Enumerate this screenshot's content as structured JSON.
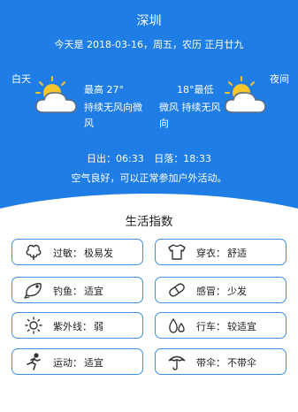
{
  "header": {
    "city": "深圳",
    "date_line": "今天是 2018-03-16，周五，农历 正月廿九"
  },
  "forecast": {
    "day_label": "白天",
    "night_label": "夜间",
    "high_temp": "最高 27°",
    "low_temp": "18°最低",
    "day_wind": "持续无风向微风",
    "night_wind": "微风 持续无风向",
    "day_icon": "partly-cloudy-sun-icon",
    "night_icon": "partly-cloudy-sun-icon"
  },
  "sun": {
    "sunrise": "日出：06:33",
    "sunset": "日落：18:33"
  },
  "advice": "空气良好，可以正常参加户外活动。",
  "life": {
    "title": "生活指数",
    "items": [
      {
        "name": "过敏：",
        "value": "极易发",
        "icon": "flower-icon"
      },
      {
        "name": "穿衣：",
        "value": "舒适",
        "icon": "tshirt-icon"
      },
      {
        "name": "钓鱼：",
        "value": "适宜",
        "icon": "fish-icon"
      },
      {
        "name": "感冒：",
        "value": "少发",
        "icon": "pill-icon"
      },
      {
        "name": "紫外线：",
        "value": "弱",
        "icon": "sun-icon"
      },
      {
        "name": "行车：",
        "value": "较适宜",
        "icon": "drops-icon"
      },
      {
        "name": "运动：",
        "value": "适宜",
        "icon": "runner-icon"
      },
      {
        "name": "带伞：",
        "value": "不带伞",
        "icon": "umbrella-icon"
      }
    ]
  },
  "colors": {
    "header_bg": "#1f7de6",
    "card_border": "#3f8fe0",
    "icon_sun": "#f5c52a"
  }
}
